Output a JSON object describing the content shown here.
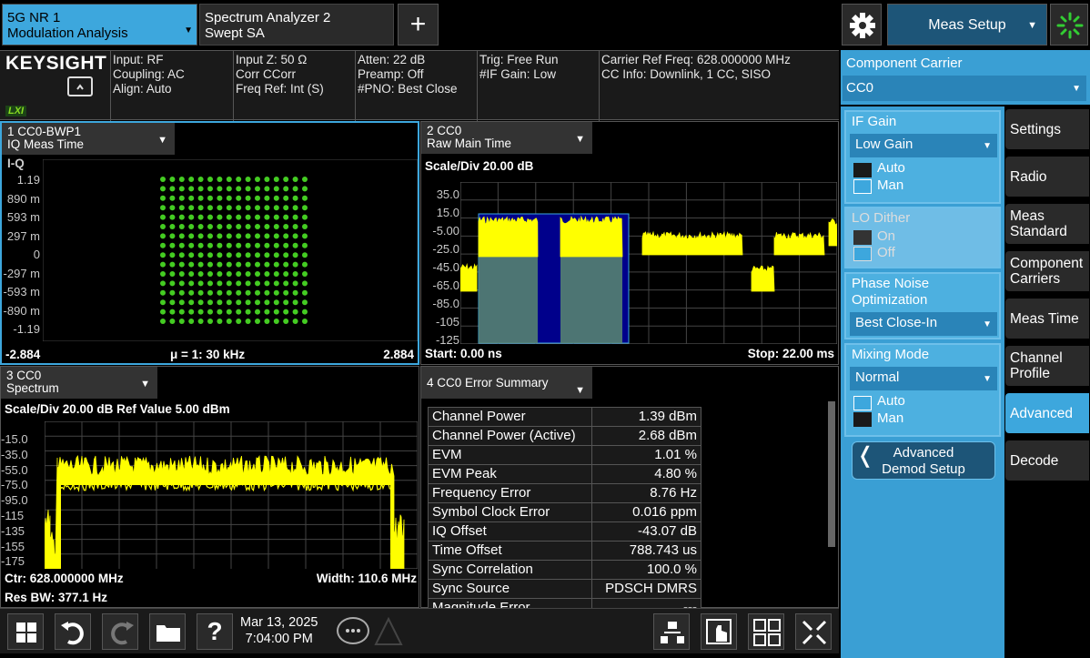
{
  "tabs": [
    {
      "line1": "5G NR 1",
      "line2": "Modulation Analysis"
    },
    {
      "line1": "Spectrum Analyzer 2",
      "line2": "Swept SA"
    }
  ],
  "add_tab_symbol": "+",
  "meas_setup_label": "Meas Setup",
  "brand": "KEYSIGHT",
  "lxi": "LXI",
  "info": {
    "col1": [
      "Input: RF",
      "Coupling: AC",
      "Align: Auto"
    ],
    "col2": [
      "Input Z: 50 Ω",
      "Corr CCorr",
      "Freq Ref: Int (S)"
    ],
    "col3": [
      "Atten: 22 dB",
      "Preamp: Off",
      "#PNO: Best Close"
    ],
    "col4": [
      "Trig: Free Run",
      "#IF Gain: Low"
    ],
    "col5": [
      "Carrier Ref Freq: 628.000000 MHz",
      "CC Info: Downlink, 1 CC, SISO"
    ]
  },
  "win1": {
    "title1": "1 CC0-BWP1",
    "title2": "IQ Meas Time",
    "subtitle": "I-Q",
    "yticks": [
      "1.19",
      "890 m",
      "593 m",
      "297 m",
      "0",
      "-297 m",
      "-593 m",
      "-890 m",
      "-1.19"
    ],
    "footer_left": "-2.884",
    "footer_mid": "μ = 1: 30 kHz",
    "footer_right": "2.884"
  },
  "win2": {
    "title1": "2 CC0",
    "title2": "Raw Main Time",
    "scale": "Scale/Div 20.00 dB",
    "yticks": [
      "35.0",
      "15.0",
      "-5.00",
      "-25.0",
      "-45.0",
      "-65.0",
      "-85.0",
      "-105",
      "-125"
    ],
    "footer_left": "Start: 0.00 ns",
    "footer_right": "Stop: 22.00 ms"
  },
  "win3": {
    "title1": "3 CC0",
    "title2": "Spectrum",
    "scale": "Scale/Div 20.00 dB Ref Value 5.00 dBm",
    "yticks": [
      "-15.0",
      "-35.0",
      "-55.0",
      "-75.0",
      "-95.0",
      "-115",
      "-135",
      "-155",
      "-175"
    ],
    "footer1_left": "Ctr: 628.000000 MHz",
    "footer1_right": "Width: 110.6 MHz",
    "footer2_left": "Res BW: 377.1 Hz"
  },
  "win4": {
    "title": "4 CC0 Error Summary",
    "rows": [
      [
        "Channel Power",
        "1.39 dBm"
      ],
      [
        "Channel Power (Active)",
        "2.68 dBm"
      ],
      [
        "EVM",
        "1.01 %"
      ],
      [
        "EVM Peak",
        "4.80 %"
      ],
      [
        "Frequency Error",
        "8.76 Hz"
      ],
      [
        "Symbol Clock Error",
        "0.016 ppm"
      ],
      [
        "IQ Offset",
        "-43.07 dB"
      ],
      [
        "Time Offset",
        "788.743 us"
      ],
      [
        "Sync Correlation",
        "100.0 %"
      ],
      [
        "Sync Source",
        "PDSCH DMRS"
      ],
      [
        "Magnitude Error",
        "---"
      ]
    ]
  },
  "panel": {
    "component_carrier_label": "Component Carrier",
    "component_carrier_value": "CC0",
    "if_gain_label": "IF Gain",
    "if_gain_value": "Low Gain",
    "if_auto": "Auto",
    "if_man": "Man",
    "lo_dither_label": "LO Dither",
    "lo_on": "On",
    "lo_off": "Off",
    "phase_noise_label1": "Phase Noise",
    "phase_noise_label2": "Optimization",
    "phase_noise_value": "Best Close-In",
    "mixing_label": "Mixing Mode",
    "mixing_value": "Normal",
    "mix_auto": "Auto",
    "mix_man": "Man",
    "adv_demod1": "Advanced",
    "adv_demod2": "Demod Setup"
  },
  "side_menu": [
    {
      "line1": "Settings",
      "line2": ""
    },
    {
      "line1": "Radio",
      "line2": ""
    },
    {
      "line1": "Meas",
      "line2": "Standard"
    },
    {
      "line1": "Component",
      "line2": "Carriers"
    },
    {
      "line1": "Meas Time",
      "line2": ""
    },
    {
      "line1": "Channel",
      "line2": "Profile"
    },
    {
      "line1": "Advanced",
      "line2": ""
    },
    {
      "line1": "Decode",
      "line2": ""
    }
  ],
  "taskbar": {
    "date": "Mar 13, 2025",
    "time": "7:04:00 PM",
    "help": "?"
  },
  "colors": {
    "accent": "#3da7dd",
    "trace": "#ffff00",
    "constellation": "#44cc22",
    "window_border": "#3da7dd"
  }
}
